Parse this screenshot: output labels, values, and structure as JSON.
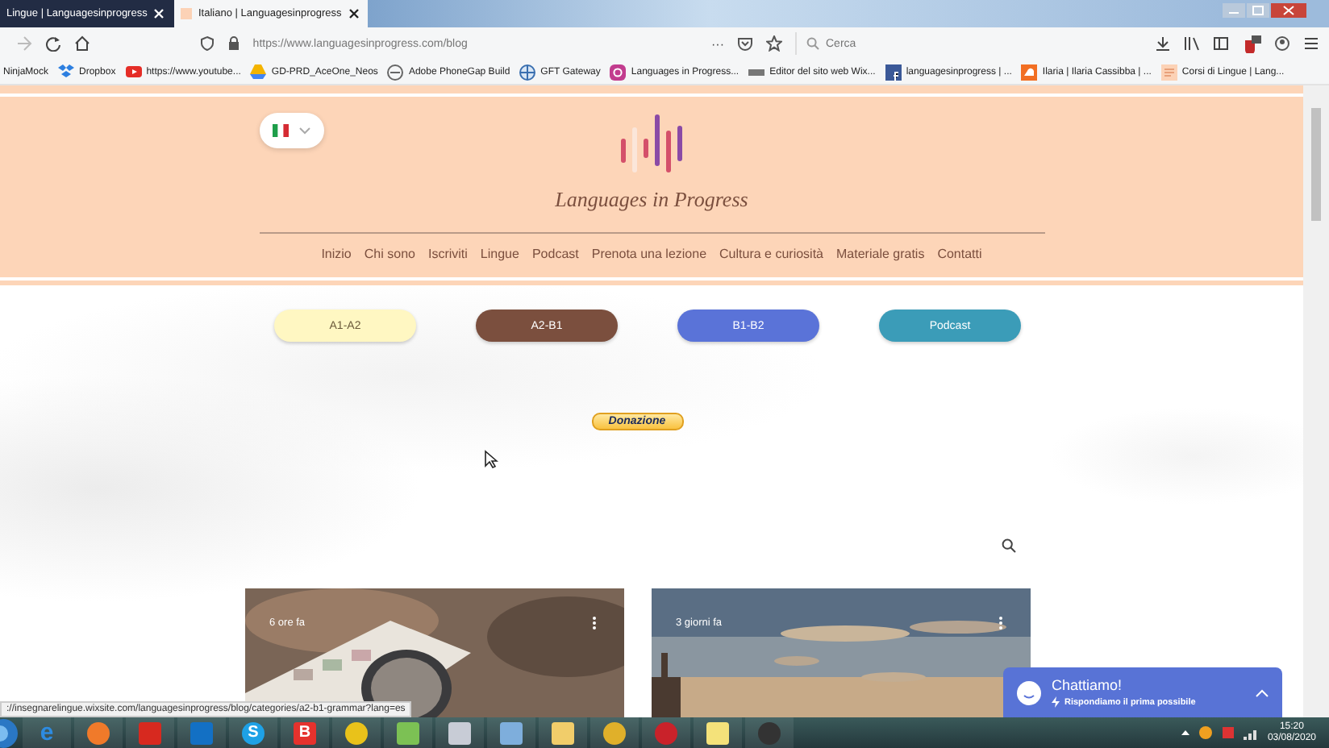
{
  "browser": {
    "tabs": [
      {
        "title": "Lingue | Languagesinprogress",
        "selected": false
      },
      {
        "title": "Italiano | Languagesinprogress",
        "selected": true
      }
    ],
    "address": "https://www.languagesinprogress.com/blog",
    "more": "···",
    "search": {
      "placeholder": "Cerca"
    },
    "bookmarks": [
      {
        "label": "NinjaMock"
      },
      {
        "label": "Dropbox"
      },
      {
        "label": "https://www.youtube..."
      },
      {
        "label": "GD-PRD_AceOne_Neos"
      },
      {
        "label": "Adobe PhoneGap Build"
      },
      {
        "label": "GFT Gateway"
      },
      {
        "label": "Languages in Progress..."
      },
      {
        "label": "Editor del sito web Wix..."
      },
      {
        "label": "languagesinprogress | ..."
      },
      {
        "label": "Ilaria | Ilaria Cassibba | ..."
      },
      {
        "label": "Corsi di Lingue | Lang..."
      }
    ]
  },
  "site": {
    "title": "Languages in Progress",
    "nav": [
      "Inizio",
      "Chi sono",
      "Iscriviti",
      "Lingue",
      "Podcast",
      "Prenota una lezione",
      "Cultura e curiosità",
      "Materiale gratis",
      "Contatti"
    ],
    "level_buttons": [
      {
        "label": "A1-A2",
        "color": "#fff7c2"
      },
      {
        "label": "A2-B1",
        "color": "#7b4f3e"
      },
      {
        "label": "B1-B2",
        "color": "#5a73d8"
      },
      {
        "label": "Podcast",
        "color": "#3b9cb8"
      }
    ],
    "donate": "Donazione",
    "posts": [
      {
        "time": "6 ore fa"
      },
      {
        "time": "3 giorni fa"
      }
    ]
  },
  "status_url": "://insegnarelingue.wixsite.com/languagesinprogress/blog/categories/a2-b1-grammar?lang=es",
  "chat": {
    "title": "Chattiamo!",
    "subtitle": "Rispondiamo il prima possibile"
  },
  "taskbar": {
    "apps": [
      {
        "kind": "ie",
        "label": "e"
      },
      {
        "kind": "firefox"
      },
      {
        "kind": "pdf"
      },
      {
        "kind": "outlook"
      },
      {
        "kind": "skype",
        "label": "S"
      },
      {
        "kind": "red",
        "label": "B"
      },
      {
        "kind": "yellow"
      },
      {
        "kind": "chart"
      },
      {
        "kind": "tool"
      },
      {
        "kind": "doc"
      },
      {
        "kind": "folder"
      },
      {
        "kind": "chrome"
      },
      {
        "kind": "redcircle"
      },
      {
        "kind": "notes"
      },
      {
        "kind": "obs"
      }
    ],
    "time": "15:20",
    "date": "03/08/2020"
  }
}
